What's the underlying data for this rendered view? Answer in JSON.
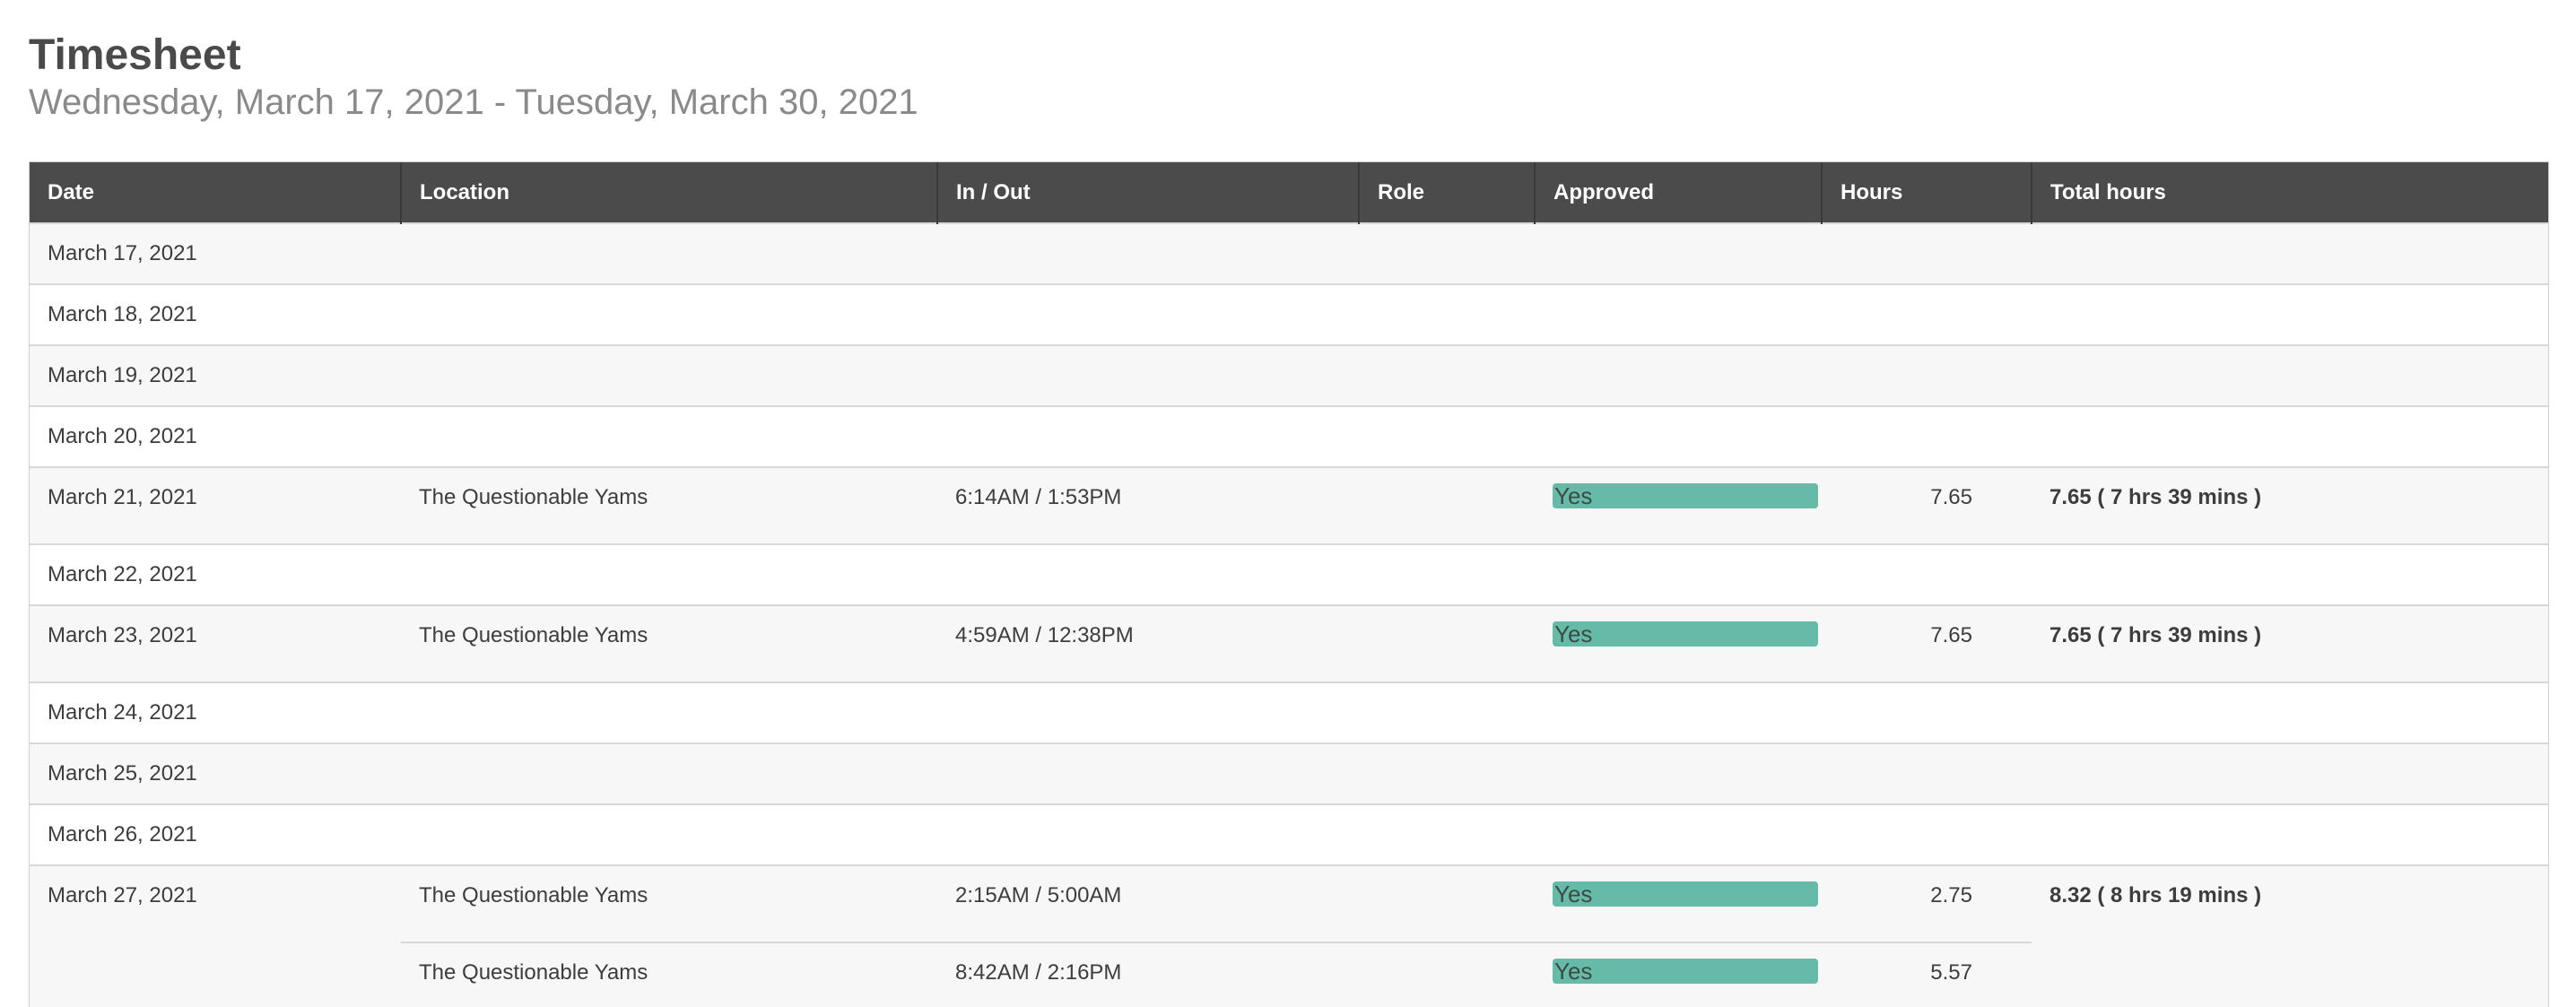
{
  "header": {
    "title": "Timesheet",
    "subtitle": "Wednesday, March 17, 2021 - Tuesday, March 30, 2021"
  },
  "table": {
    "columns": [
      "Date",
      "Location",
      "In / Out",
      "Role",
      "Approved",
      "Hours",
      "Total hours"
    ],
    "days": [
      {
        "date": "March 17, 2021"
      },
      {
        "date": "March 18, 2021"
      },
      {
        "date": "March 19, 2021"
      },
      {
        "date": "March 20, 2021"
      },
      {
        "date": "March 21, 2021",
        "location": "The Questionable Yams",
        "in_out": "6:14AM / 1:53PM",
        "role": "",
        "approved": "Yes",
        "hours": "7.65",
        "total": "7.65 ( 7 hrs 39 mins )"
      },
      {
        "date": "March 22, 2021"
      },
      {
        "date": "March 23, 2021",
        "location": "The Questionable Yams",
        "in_out": "4:59AM / 12:38PM",
        "role": "",
        "approved": "Yes",
        "hours": "7.65",
        "total": "7.65 ( 7 hrs 39 mins )"
      },
      {
        "date": "March 24, 2021"
      },
      {
        "date": "March 25, 2021"
      },
      {
        "date": "March 26, 2021"
      },
      {
        "date": "March 27, 2021",
        "location": "The Questionable Yams",
        "in_out": "2:15AM / 5:00AM",
        "role": "",
        "approved": "Yes",
        "hours": "2.75",
        "total": "8.32 ( 8 hrs 19 mins )",
        "extra": {
          "location": "The Questionable Yams",
          "in_out": "8:42AM / 2:16PM",
          "role": "",
          "approved": "Yes",
          "hours": "5.57"
        }
      }
    ]
  },
  "colors": {
    "header_bg": "#4b4b4b",
    "approved_bar": "#66bba8",
    "row_alt": "#f7f7f7"
  }
}
